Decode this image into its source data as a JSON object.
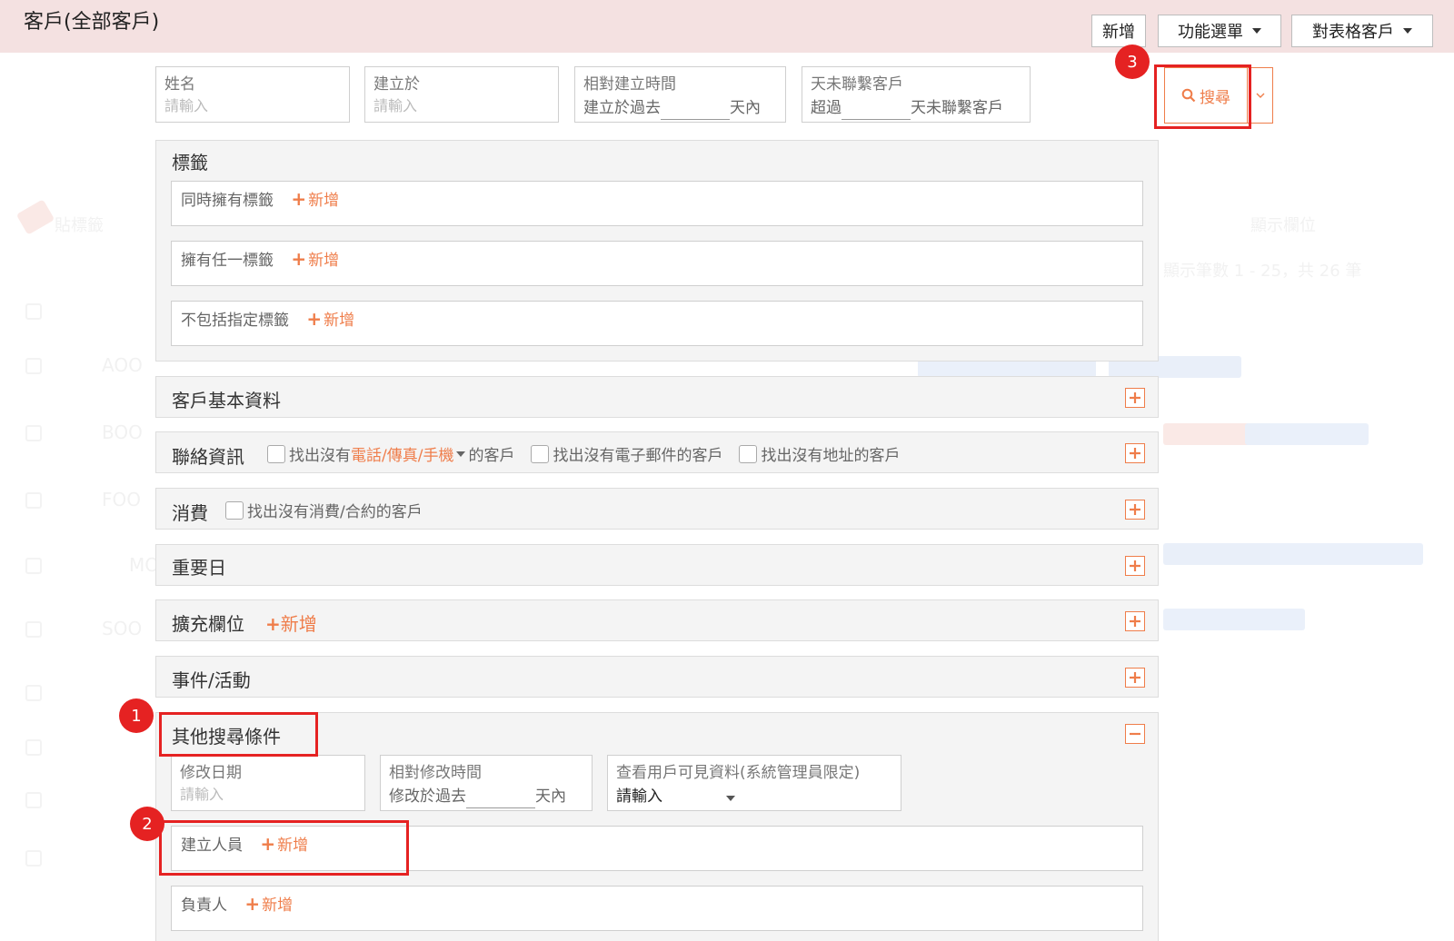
{
  "header": {
    "title": "客戶(全部客戶)",
    "new_button": "新增",
    "function_menu": "功能選單",
    "table_customers": "對表格客戶"
  },
  "filters": {
    "name": {
      "label": "姓名",
      "placeholder": "請輸入"
    },
    "created_at": {
      "label": "建立於",
      "placeholder": "請輸入"
    },
    "relative_created": {
      "label": "相對建立時間",
      "prefix": "建立於過去",
      "suffix": "天內"
    },
    "no_contact": {
      "label": "天未聯繫客戶",
      "prefix": "超過",
      "suffix": "天未聯繫客戶"
    },
    "search_button": "搜尋"
  },
  "tags_section": {
    "title": "標籤",
    "rows": [
      {
        "label": "同時擁有標籤",
        "add": "新增"
      },
      {
        "label": "擁有任一標籤",
        "add": "新增"
      },
      {
        "label": "不包括指定標籤",
        "add": "新增"
      }
    ]
  },
  "sections": {
    "basic": {
      "title": "客戶基本資料"
    },
    "contact": {
      "title": "聯絡資訊",
      "opt1_prefix": "找出沒有",
      "opt1_highlight": "電話/傳真/手機",
      "opt1_suffix": "的客戶",
      "opt2": "找出沒有電子郵件的客戶",
      "opt3": "找出沒有地址的客戶"
    },
    "consumption": {
      "title": "消費",
      "opt": "找出沒有消費/合約的客戶"
    },
    "important_dates": {
      "title": "重要日"
    },
    "extended_fields": {
      "title": "擴充欄位",
      "add": "新增"
    },
    "events": {
      "title": "事件/活動"
    },
    "other": {
      "title": "其他搜尋條件",
      "modified_date": {
        "label": "修改日期",
        "placeholder": "請輸入"
      },
      "relative_modified": {
        "label": "相對修改時間",
        "prefix": "修改於過去",
        "suffix": "天內"
      },
      "visible_data": {
        "label": "查看用戶可見資料(系統管理員限定)",
        "value": "請輸入"
      },
      "creator": {
        "label": "建立人員",
        "add": "新增"
      },
      "owner": {
        "label": "負責人",
        "add": "新增"
      }
    }
  },
  "callouts": {
    "one": "1",
    "two": "2",
    "three": "3"
  },
  "background_list": {
    "toolbar_label": "貼標籤",
    "display_fields": "顯示欄位",
    "pagination": "顯示筆數 1 - 25，共 26 筆",
    "rows": [
      "AOO",
      "BOO",
      "FOO",
      "MO",
      "SOO"
    ]
  },
  "colors": {
    "accent": "#ef7d4a",
    "header_bg": "#f4e1e1",
    "callout": "#e52222"
  }
}
